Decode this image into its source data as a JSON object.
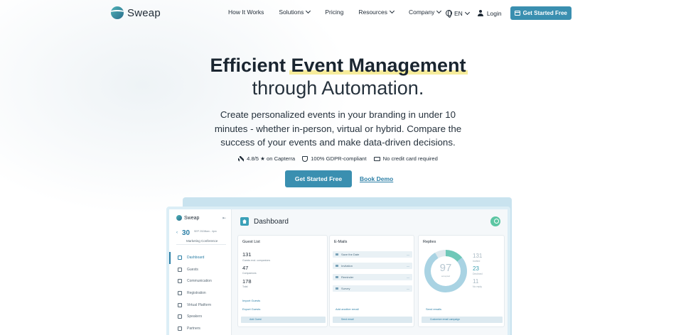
{
  "brand": {
    "name": "Sweap"
  },
  "nav": {
    "links": [
      {
        "label": "How It Works",
        "dropdown": false
      },
      {
        "label": "Solutions",
        "dropdown": true
      },
      {
        "label": "Pricing",
        "dropdown": false
      },
      {
        "label": "Resources",
        "dropdown": true
      },
      {
        "label": "Company",
        "dropdown": true
      }
    ],
    "language": "EN",
    "login": "Login",
    "cta": "Get Started Free"
  },
  "hero": {
    "title_prefix": "Efficient ",
    "title_highlight": "Event Management",
    "title_line2": "through Automation.",
    "subtitle": "Create personalized events in your branding in under 10 minutes - whether in-person, virtual or hybrid. Compare the success of your events and make data-driven decisions.",
    "badges": [
      {
        "icon": "arrow-icon",
        "label": "4.8/5 ★ on Capterra"
      },
      {
        "icon": "shield-icon",
        "label": "100% GDPR-compliant"
      },
      {
        "icon": "credit-card-icon",
        "label": "No credit card required"
      }
    ],
    "cta_primary": "Get Started Free",
    "cta_secondary": "Book Demo"
  },
  "dashboard": {
    "brand": "Sweap",
    "event": {
      "day": "30",
      "month": "SEP 2024",
      "time": "9am - 4pm",
      "name": "Marketing Conference"
    },
    "sidebar": [
      "Dashboard",
      "Guests",
      "Communication",
      "Registration",
      "Virtual Platform",
      "Speakers",
      "Partners"
    ],
    "title": "Dashboard",
    "guest_list": {
      "title": "Guest List",
      "total": "131",
      "total_label": "Guests excl. companions",
      "companions": "47",
      "companions_label": "Companions",
      "total2": "178",
      "total2_label": "Total",
      "links": [
        "Import Guests",
        "Export Guests"
      ],
      "button": "Add Guest"
    },
    "emails": {
      "title": "E-Mails",
      "items": [
        "Save the Date",
        "Invitation",
        "Reminder",
        "Survey"
      ],
      "add": "Add another email",
      "button": "Send email"
    },
    "replies": {
      "title": "Replies",
      "percent": "97",
      "percent_label": "accepted",
      "stats": [
        {
          "value": "131",
          "label": "Invited"
        },
        {
          "value": "23",
          "label": "Declined"
        },
        {
          "value": "11",
          "label": "No reply"
        }
      ],
      "link": "Send emails",
      "button": "Customize email campaign"
    },
    "colors": {
      "accent": "#3a8fb0",
      "green": "#5cc6a3",
      "teal": "#6fc8b8"
    }
  }
}
